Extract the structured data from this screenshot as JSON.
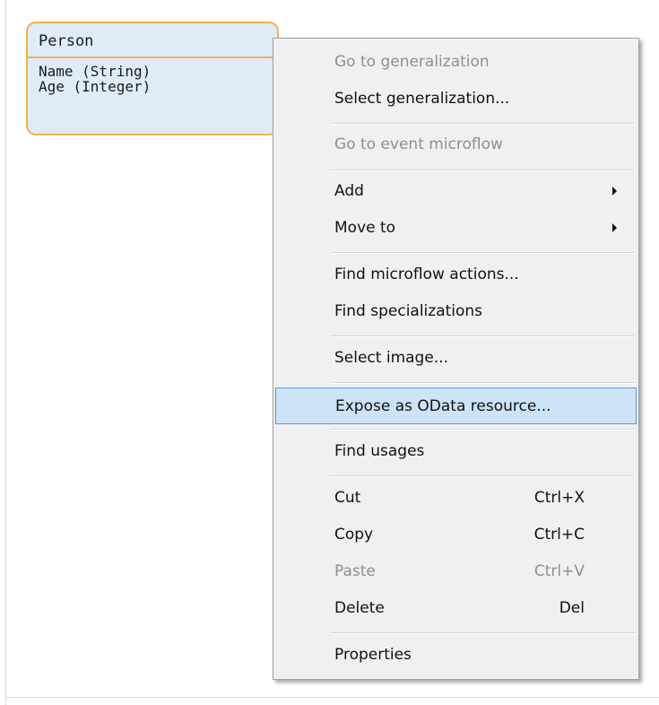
{
  "entity": {
    "name": "Person",
    "attributes": [
      "Name (String)",
      "Age (Integer)"
    ]
  },
  "context_menu": {
    "items": [
      {
        "label": "Go to generalization",
        "shortcut": "",
        "enabled": false,
        "submenu": false
      },
      {
        "label": "Select generalization...",
        "shortcut": "",
        "enabled": true,
        "submenu": false
      },
      {
        "label": "Go to event microflow",
        "shortcut": "",
        "enabled": false,
        "submenu": false
      },
      {
        "label": "Add",
        "shortcut": "",
        "enabled": true,
        "submenu": true
      },
      {
        "label": "Move to",
        "shortcut": "",
        "enabled": true,
        "submenu": true
      },
      {
        "label": "Find microflow actions...",
        "shortcut": "",
        "enabled": true,
        "submenu": false
      },
      {
        "label": "Find specializations",
        "shortcut": "",
        "enabled": true,
        "submenu": false
      },
      {
        "label": "Select image...",
        "shortcut": "",
        "enabled": true,
        "submenu": false
      },
      {
        "label": "Expose as OData resource...",
        "shortcut": "",
        "enabled": true,
        "submenu": false,
        "highlighted": true
      },
      {
        "label": "Find usages",
        "shortcut": "",
        "enabled": true,
        "submenu": false
      },
      {
        "label": "Cut",
        "shortcut": "Ctrl+X",
        "enabled": true,
        "submenu": false
      },
      {
        "label": "Copy",
        "shortcut": "Ctrl+C",
        "enabled": true,
        "submenu": false
      },
      {
        "label": "Paste",
        "shortcut": "Ctrl+V",
        "enabled": false,
        "submenu": false
      },
      {
        "label": "Delete",
        "shortcut": "Del",
        "enabled": true,
        "submenu": false
      },
      {
        "label": "Properties",
        "shortcut": "",
        "enabled": true,
        "submenu": false
      }
    ]
  },
  "colors": {
    "entity_fill": "#dfecf8",
    "entity_border": "#eeb34e",
    "menu_background": "#f0f0f0",
    "highlight_fill": "#cde3f7",
    "highlight_border": "#5a9bd6",
    "disabled_text": "#8f8f8f"
  }
}
